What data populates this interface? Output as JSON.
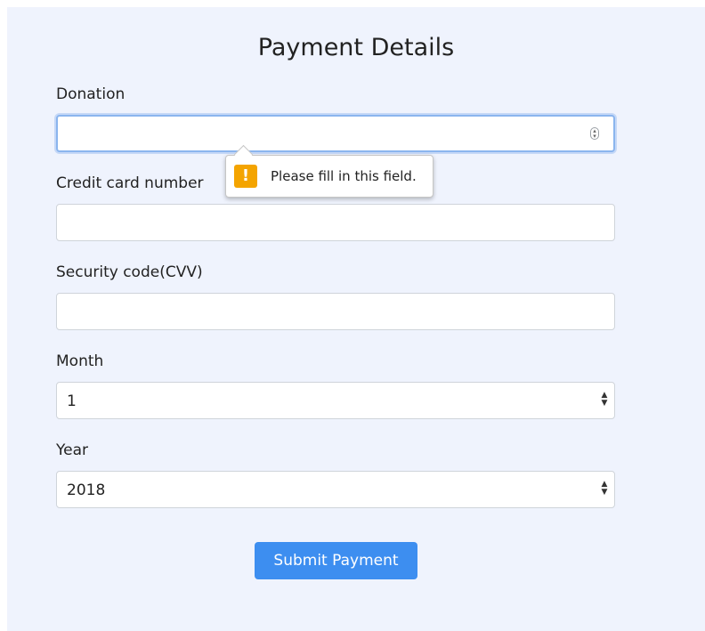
{
  "form": {
    "title": "Payment Details",
    "donation": {
      "label": "Donation",
      "value": ""
    },
    "card_number": {
      "label": "Credit card number",
      "value": ""
    },
    "cvv": {
      "label": "Security code(CVV)",
      "value": ""
    },
    "month": {
      "label": "Month",
      "selected": "1"
    },
    "year": {
      "label": "Year",
      "selected": "2018"
    },
    "submit_label": "Submit Payment"
  },
  "validation_tooltip": {
    "icon": "warning-icon",
    "message": "Please fill in this field.",
    "accent_color": "#f4a400"
  },
  "colors": {
    "panel_background": "#eff3fd",
    "submit_button": "#3d8ef0",
    "focus_ring": "#8bb5ee"
  }
}
